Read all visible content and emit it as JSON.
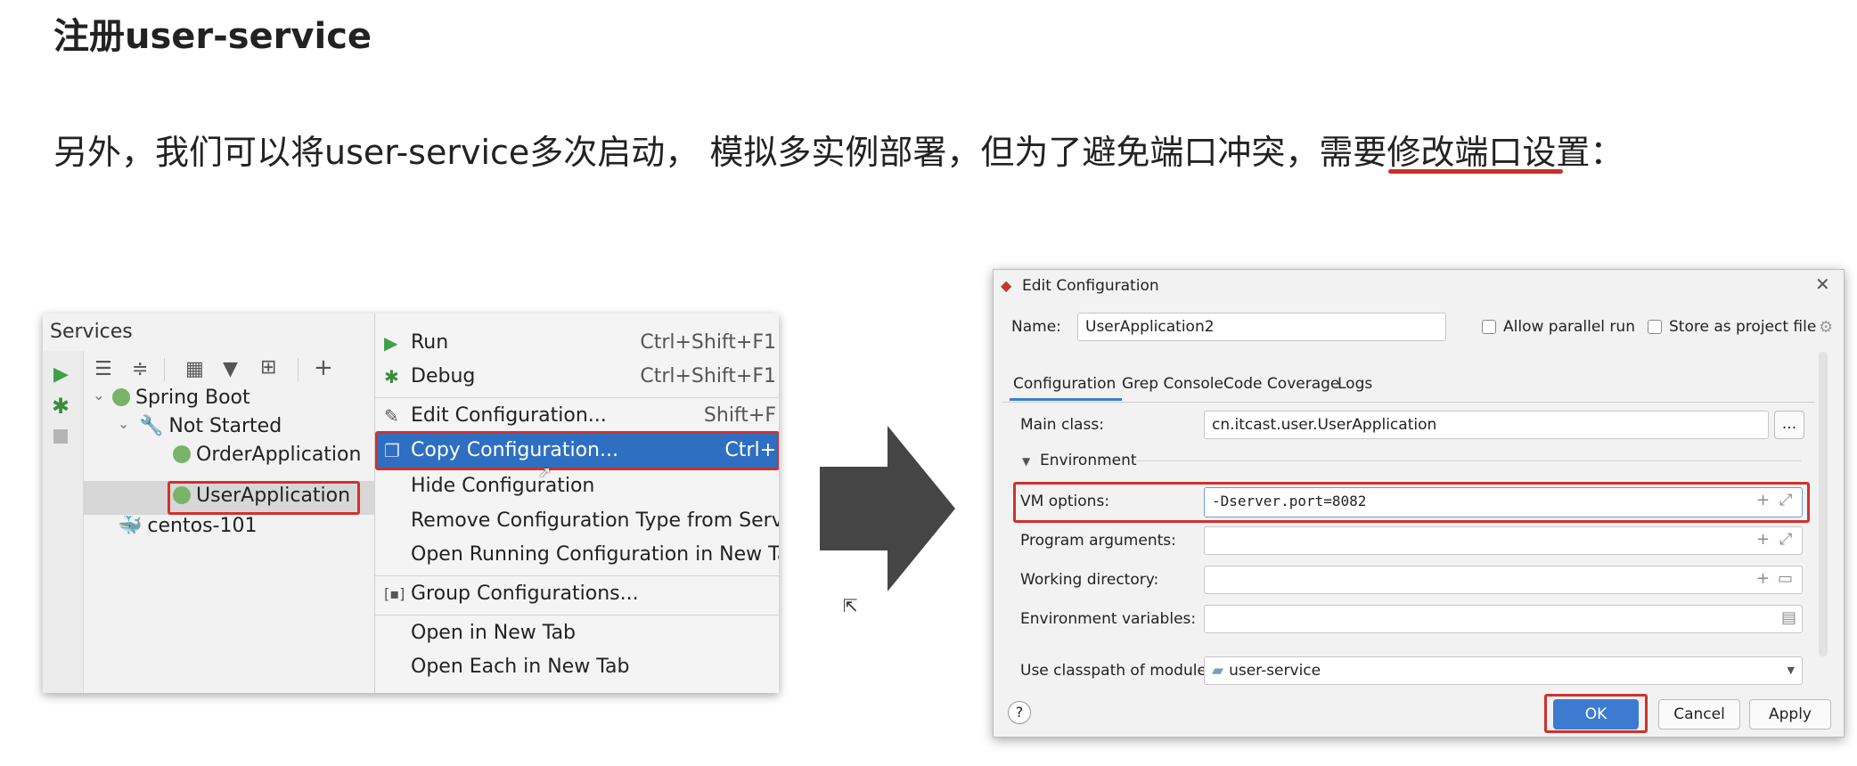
{
  "page": {
    "title": "注册user-service",
    "subtitle": "另外，我们可以将user-service多次启动， 模拟多实例部署，但为了避免端口冲突，需要修改端口设置："
  },
  "services": {
    "title": "Services",
    "tree": {
      "spring_boot": "Spring Boot",
      "not_started": "Not Started",
      "order_app": "OrderApplication",
      "user_app": "UserApplication",
      "centos": "centos-101"
    }
  },
  "context_menu": {
    "items": [
      {
        "label": "Run",
        "shortcut": "Ctrl+Shift+F1"
      },
      {
        "label": "Debug",
        "shortcut": "Ctrl+Shift+F1"
      },
      {
        "label": "Edit Configuration...",
        "shortcut": "Shift+F"
      },
      {
        "label": "Copy Configuration...",
        "shortcut": "Ctrl+"
      },
      {
        "label": "Hide Configuration",
        "shortcut": ""
      },
      {
        "label": "Remove Configuration Type from Services",
        "shortcut": ""
      },
      {
        "label": "Open Running Configuration in New Tab",
        "shortcut": ""
      },
      {
        "label": "Group Configurations...",
        "shortcut": ""
      },
      {
        "label": "Open in New Tab",
        "shortcut": ""
      },
      {
        "label": "Open Each in New Tab",
        "shortcut": ""
      }
    ]
  },
  "dialog": {
    "title": "Edit Configuration",
    "name_label": "Name:",
    "name_value": "UserApplication2",
    "allow_parallel": "Allow parallel run",
    "store_project": "Store as project file",
    "tabs": [
      "Configuration",
      "Grep Console",
      "Code Coverage",
      "Logs"
    ],
    "main_class_label": "Main class:",
    "main_class_value": "cn.itcast.user.UserApplication",
    "environment_label": "Environment",
    "vm_label": "VM options:",
    "vm_value": "-Dserver.port=8082",
    "program_args_label": "Program arguments:",
    "working_dir_label": "Working directory:",
    "env_vars_label": "Environment variables:",
    "classpath_label": "Use classpath of module:",
    "classpath_value": "user-service",
    "ok": "OK",
    "cancel": "Cancel",
    "apply": "Apply",
    "help": "?"
  },
  "colors": {
    "highlight_red": "#d0312d",
    "menu_selected": "#2f6fc1",
    "ok_button": "#3d7bd1",
    "arrow": "#454545"
  }
}
